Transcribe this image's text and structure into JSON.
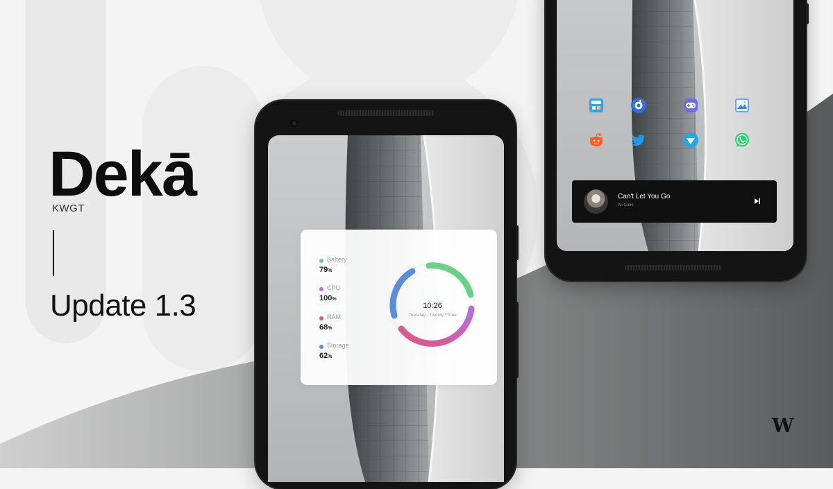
{
  "branding": {
    "title": "Dekā",
    "subtitle": "KWGT",
    "update_label": "Update 1.3",
    "logo": "W"
  },
  "colors": {
    "battery": "#6ad08a",
    "cpu": "#b56ee0",
    "ram": "#e0567f",
    "storage": "#5b8ddb"
  },
  "system_widget": {
    "stats": [
      {
        "label": "Battery",
        "value": "79",
        "unit": "%"
      },
      {
        "label": "CPU",
        "value": "100",
        "unit": "%"
      },
      {
        "label": "RAM",
        "value": "68",
        "unit": "%"
      },
      {
        "label": "Storage",
        "value": "62",
        "unit": "%"
      }
    ],
    "time": "10:26",
    "date": "Tuesday - Twenty Three"
  },
  "home_screen": {
    "app_icons": [
      "calculator-app-icon",
      "music-player-app-icon",
      "game-controller-app-icon",
      "gallery-app-icon",
      "reddit-app-icon",
      "twitter-app-icon",
      "telegram-app-icon",
      "whatsapp-app-icon"
    ]
  },
  "music_widget": {
    "song": "Can't Let You Go",
    "artist": "Ali Gatie",
    "control_icon": "skip-next-icon"
  }
}
